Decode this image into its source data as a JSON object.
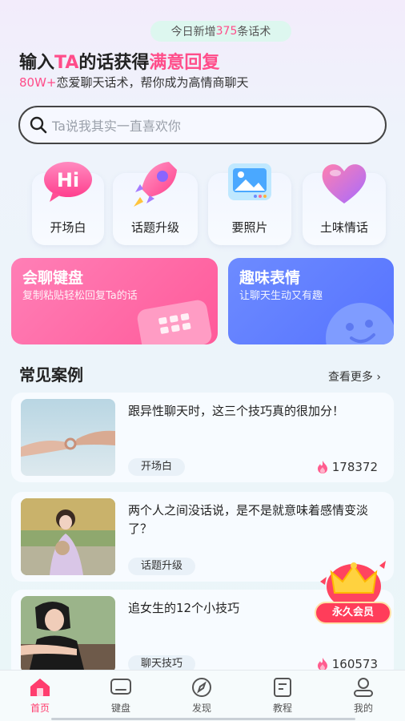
{
  "top_pill": {
    "prefix": "今日新增",
    "count": "375",
    "suffix": "条话术"
  },
  "headline": {
    "part1": "输入",
    "ta": "TA",
    "part2": "的话获得",
    "highlight": "满意回复"
  },
  "subline": {
    "count": "80W+",
    "text": "恋爱聊天话术，帮你成为高情商聊天"
  },
  "search": {
    "placeholder": "Ta说我其实一直喜欢你"
  },
  "categories": [
    {
      "label": "开场白",
      "icon": "hi-icon"
    },
    {
      "label": "话题升级",
      "icon": "rocket-icon"
    },
    {
      "label": "要照片",
      "icon": "photo-icon"
    },
    {
      "label": "土味情话",
      "icon": "heart-icon"
    }
  ],
  "banners": [
    {
      "title": "会聊键盘",
      "subtitle": "复制粘贴轻松回复Ta的话",
      "color": "#ff6ea6"
    },
    {
      "title": "趣味表情",
      "subtitle": "让聊天生动又有趣",
      "color": "#5b7bff"
    }
  ],
  "section": {
    "title": "常见案例",
    "more": "查看更多 ›"
  },
  "cases": [
    {
      "title": "跟异性聊天时，这三个技巧真的很加分！",
      "tag": "开场白",
      "views": "178372"
    },
    {
      "title": "两个人之间没话说，是不是就意味着感情变淡了？",
      "tag": "话题升级",
      "views": ""
    },
    {
      "title": "追女生的12个小技巧",
      "tag": "聊天技巧",
      "views": "160573"
    }
  ],
  "vip": {
    "label": "永久会员"
  },
  "tabs": [
    {
      "label": "首页",
      "icon": "home-icon",
      "active": true
    },
    {
      "label": "键盘",
      "icon": "keyboard-icon"
    },
    {
      "label": "发现",
      "icon": "compass-icon"
    },
    {
      "label": "教程",
      "icon": "tutorial-icon"
    },
    {
      "label": "我的",
      "icon": "profile-icon"
    }
  ],
  "colors": {
    "accent": "#ff4d8a",
    "active_tab": "#ff3d6e"
  }
}
